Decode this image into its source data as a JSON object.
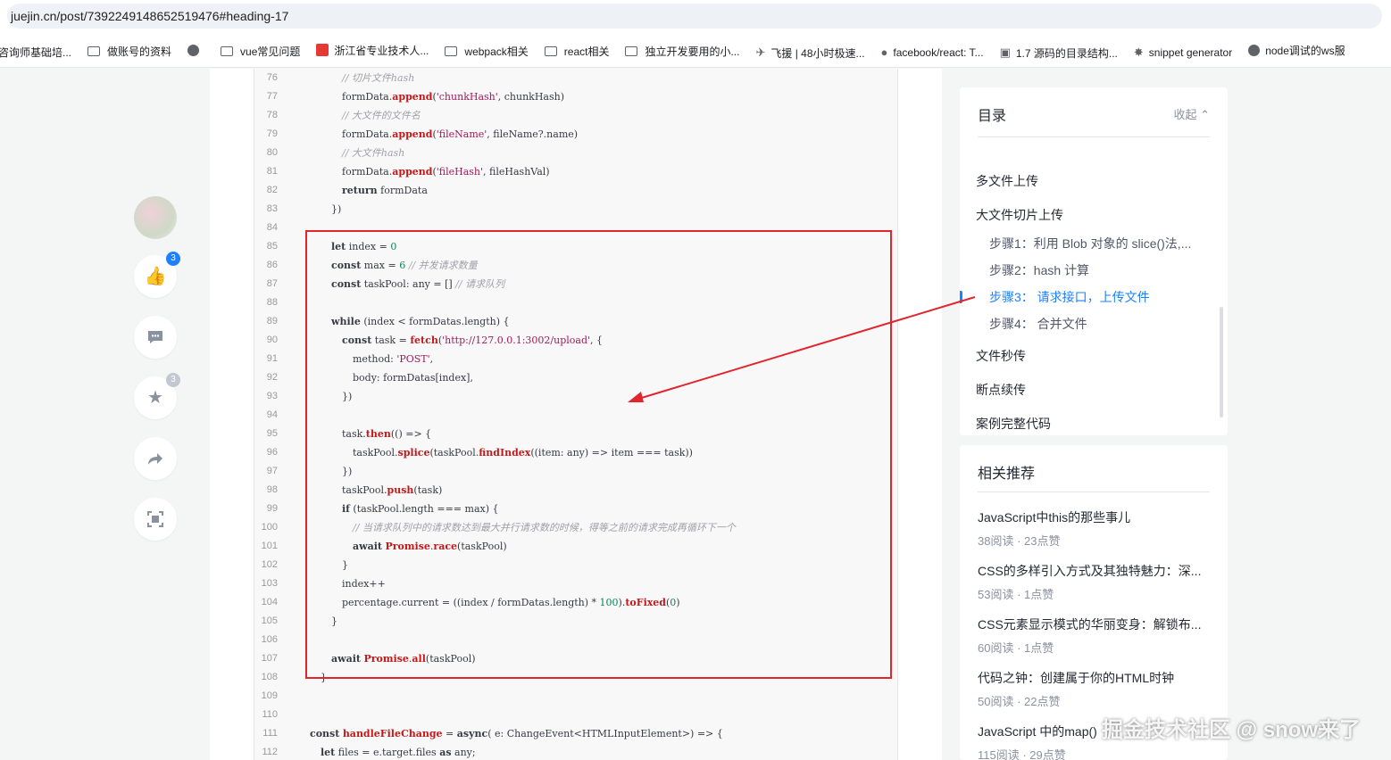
{
  "browser": {
    "url": "juejin.cn/post/7392249148652519476#heading-17"
  },
  "bookmarks": [
    {
      "icon": "folder-icon",
      "label": "咨询师基础培..."
    },
    {
      "icon": "folder-icon",
      "label": "做账号的资料"
    },
    {
      "icon": "globe-icon",
      "label": ""
    },
    {
      "icon": "folder-icon",
      "label": "vue常见问题"
    },
    {
      "icon": "site-icon",
      "label": "浙江省专业技术人..."
    },
    {
      "icon": "folder-icon",
      "label": "webpack相关"
    },
    {
      "icon": "folder-icon",
      "label": "react相关"
    },
    {
      "icon": "folder-icon",
      "label": "独立开发要用的小..."
    },
    {
      "icon": "feather-icon",
      "label": "飞援 | 48小时极速..."
    },
    {
      "icon": "github-icon",
      "label": "facebook/react: T..."
    },
    {
      "icon": "tv-icon",
      "label": "1.7 源码的目录结构..."
    },
    {
      "icon": "star-icon",
      "label": "snippet generator"
    },
    {
      "icon": "globe-icon",
      "label": "node调试的ws服"
    }
  ],
  "actions": {
    "like_count": "3",
    "collect_count": "3",
    "colors": {
      "like_badge": "#1e80ff",
      "collect_badge": "#c2c8d1"
    }
  },
  "code": {
    "lines": [
      {
        "n": "76",
        "html": "<span class=\"c-cm\">// 切片文件hash</span>",
        "indent": 5
      },
      {
        "n": "77",
        "html": "formData.<span class=\"c-fn\">append</span>(<span class=\"c-str\">'chunkHash'</span>, chunkHash)",
        "indent": 5
      },
      {
        "n": "78",
        "html": "<span class=\"c-cm\">// 大文件的文件名</span>",
        "indent": 5
      },
      {
        "n": "79",
        "html": "formData.<span class=\"c-fn\">append</span>(<span class=\"c-str\">'fileName'</span>, fileName?.name)",
        "indent": 5
      },
      {
        "n": "80",
        "html": "<span class=\"c-cm\">// 大文件hash</span>",
        "indent": 5
      },
      {
        "n": "81",
        "html": "formData.<span class=\"c-fn\">append</span>(<span class=\"c-str\">'fileHash'</span>, fileHashVal)",
        "indent": 5
      },
      {
        "n": "82",
        "html": "<span class=\"c-kw\">return</span> formData",
        "indent": 5
      },
      {
        "n": "83",
        "html": "})",
        "indent": 4
      },
      {
        "n": "84",
        "html": "",
        "indent": 0
      },
      {
        "n": "85",
        "html": "<span class=\"c-kw\">let</span> index = <span class=\"c-num\">0</span>",
        "indent": 4
      },
      {
        "n": "86",
        "html": "<span class=\"c-kw\">const</span> max = <span class=\"c-num\">6</span> <span class=\"c-cm\">// 并发请求数量</span>",
        "indent": 4
      },
      {
        "n": "87",
        "html": "<span class=\"c-kw\">const</span> taskPool: any = [] <span class=\"c-cm\">// 请求队列</span>",
        "indent": 4
      },
      {
        "n": "88",
        "html": "",
        "indent": 0
      },
      {
        "n": "89",
        "html": "<span class=\"c-kw\">while</span> (index &lt; formDatas.length) {",
        "indent": 4
      },
      {
        "n": "90",
        "html": "<span class=\"c-kw\">const</span> task = <span class=\"c-fn\">fetch</span>(<span class=\"c-str\">'http://127.0.0.1:3002/upload'</span>, {",
        "indent": 5
      },
      {
        "n": "91",
        "html": "method: <span class=\"c-str\">'POST'</span>,",
        "indent": 6
      },
      {
        "n": "92",
        "html": "body: formDatas[index],",
        "indent": 6
      },
      {
        "n": "93",
        "html": "})",
        "indent": 5
      },
      {
        "n": "94",
        "html": "",
        "indent": 0
      },
      {
        "n": "95",
        "html": "task.<span class=\"c-fn\">then</span>(() =&gt; {",
        "indent": 5
      },
      {
        "n": "96",
        "html": "taskPool.<span class=\"c-fn\">splice</span>(taskPool.<span class=\"c-fn\">findIndex</span>((item: any) =&gt; item === task))",
        "indent": 6
      },
      {
        "n": "97",
        "html": "})",
        "indent": 5
      },
      {
        "n": "98",
        "html": "taskPool.<span class=\"c-fn\">push</span>(task)",
        "indent": 5
      },
      {
        "n": "99",
        "html": "<span class=\"c-kw\">if</span> (taskPool.length === max) {",
        "indent": 5
      },
      {
        "n": "100",
        "html": "<span class=\"c-cm\">// 当请求队列中的请求数达到最大并行请求数的时候，得等之前的请求完成再循环下一个</span>",
        "indent": 6
      },
      {
        "n": "101",
        "html": "<span class=\"c-kw\">await</span> <span class=\"c-fn\">Promise</span>.<span class=\"c-fn\">race</span>(taskPool)",
        "indent": 6
      },
      {
        "n": "102",
        "html": "}",
        "indent": 5
      },
      {
        "n": "103",
        "html": "index++",
        "indent": 5
      },
      {
        "n": "104",
        "html": "percentage.current = ((index / formDatas.length) * <span class=\"c-num\">100</span>).<span class=\"c-fn\">toFixed</span>(<span class=\"c-num\">0</span>)",
        "indent": 5
      },
      {
        "n": "105",
        "html": "}",
        "indent": 4
      },
      {
        "n": "106",
        "html": "",
        "indent": 0
      },
      {
        "n": "107",
        "html": "<span class=\"c-kw\">await</span> <span class=\"c-fn\">Promise</span>.<span class=\"c-fn\">all</span>(taskPool)",
        "indent": 4
      },
      {
        "n": "108",
        "html": "}",
        "indent": 3
      },
      {
        "n": "109",
        "html": "",
        "indent": 0
      },
      {
        "n": "110",
        "html": "",
        "indent": 0
      },
      {
        "n": "111",
        "html": "<span class=\"c-kw\">const</span> <span class=\"c-fn\">handleFileChange</span> = <span class=\"c-kw\">async</span>( e: ChangeEvent&lt;HTMLInputElement&gt;) =&gt; {",
        "indent": 2
      },
      {
        "n": "112",
        "html": "<span class=\"c-kw\">let</span> files = e.target.files <span class=\"c-kw\">as</span> any;",
        "indent": 3
      }
    ]
  },
  "toc": {
    "title": "目录",
    "collapse_label": "收起",
    "items": [
      {
        "label": "多文件上传",
        "level": 1,
        "active": false
      },
      {
        "label": "大文件切片上传",
        "level": 1,
        "active": false
      },
      {
        "label": "步骤1：利用 Blob 对象的 slice()法,...",
        "level": 2,
        "active": false
      },
      {
        "label": "步骤2：hash 计算",
        "level": 2,
        "active": false
      },
      {
        "label": "步骤3：  请求接口，上传文件",
        "level": 2,
        "active": true
      },
      {
        "label": "步骤4：  合并文件",
        "level": 2,
        "active": false
      },
      {
        "label": "文件秒传",
        "level": 1,
        "active": false
      },
      {
        "label": "断点续传",
        "level": 1,
        "active": false
      },
      {
        "label": "案例完整代码",
        "level": 1,
        "active": false
      }
    ]
  },
  "recommendations": {
    "title": "相关推荐",
    "items": [
      {
        "title": "JavaScript中this的那些事儿",
        "meta": "38阅读 · 23点赞"
      },
      {
        "title": "CSS的多样引入方式及其独特魅力：深...",
        "meta": "53阅读 · 1点赞"
      },
      {
        "title": "CSS元素显示模式的华丽变身：解锁布...",
        "meta": "60阅读 · 1点赞"
      },
      {
        "title": "代码之钟：创建属于你的HTML时钟",
        "meta": "50阅读 · 22点赞"
      },
      {
        "title": "JavaScript 中的map()",
        "meta": "115阅读 · 29点赞"
      }
    ]
  },
  "watermark": "掘金技术社区 @ snow来了",
  "annotation_color": "#e3242b"
}
